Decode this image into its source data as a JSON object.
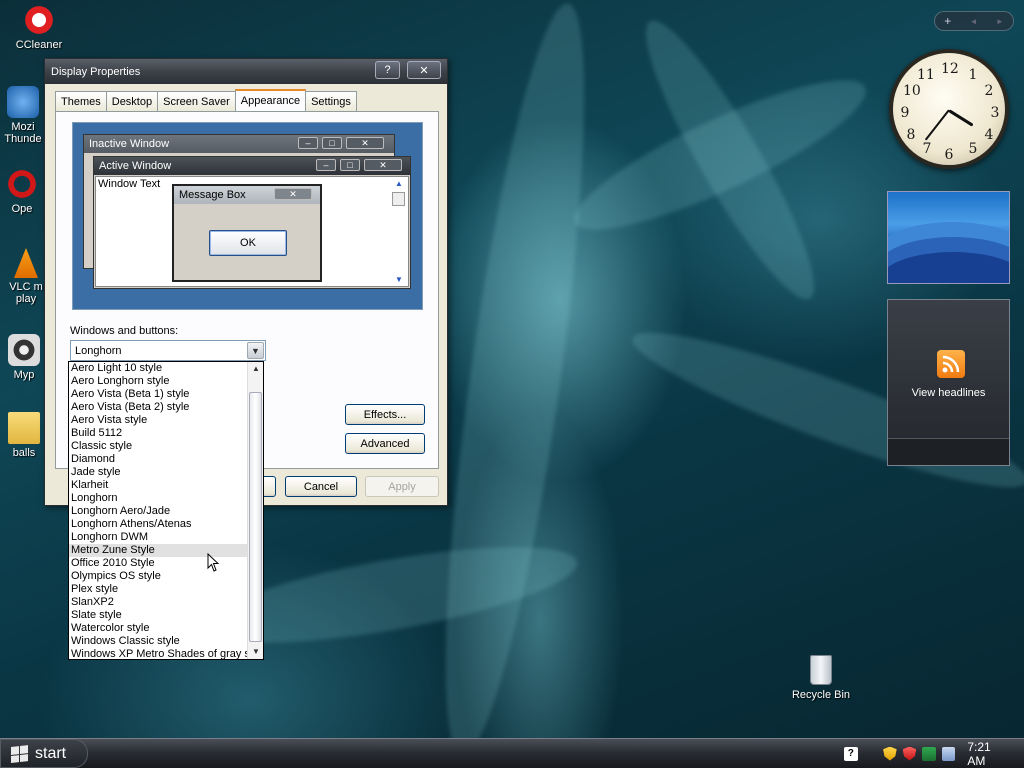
{
  "desktop_icons": [
    {
      "label": "CCleaner"
    },
    {
      "label": "Mozi\nThunde"
    },
    {
      "label": "Ope"
    },
    {
      "label": "VLC m\nplay"
    },
    {
      "label": "Myp"
    },
    {
      "label": "balls"
    }
  ],
  "recycle_bin": {
    "label": "Recycle Bin"
  },
  "gadgets": {
    "sidebar_buttons": [
      "+",
      "◄",
      "►"
    ],
    "feed": {
      "label": "View headlines",
      "icon": "rss-icon"
    },
    "clock_numbers": [
      "12",
      "1",
      "2",
      "3",
      "4",
      "5",
      "6",
      "7",
      "8",
      "9",
      "10",
      "11"
    ]
  },
  "window": {
    "title": "Display Properties",
    "help_btn": "?",
    "close_btn": "✕",
    "tabs": [
      {
        "label": "Themes"
      },
      {
        "label": "Desktop"
      },
      {
        "label": "Screen Saver"
      },
      {
        "label": "Appearance"
      },
      {
        "label": "Settings"
      }
    ],
    "preview": {
      "inactive_title": "Inactive Window",
      "active_title": "Active Window",
      "window_text": "Window Text",
      "msgbox_title": "Message Box",
      "ok": "OK"
    },
    "windows_buttons_label": "Windows and buttons:",
    "combo_value": "Longhorn",
    "effects_btn": "Effects...",
    "advanced_btn": "Advanced",
    "cancel_btn": "Cancel",
    "apply_btn": "Apply"
  },
  "dropdown_items": [
    "Aero Light 10 style",
    "Aero Longhorn style",
    "Aero Vista (Beta 1) style",
    "Aero Vista (Beta 2) style",
    "Aero Vista style",
    "Build 5112",
    "Classic style",
    "Diamond",
    "Jade style",
    "Klarheit",
    "Longhorn",
    "Longhorn Aero/Jade",
    "Longhorn Athens/Atenas",
    "Longhorn DWM",
    "Metro Zune Style",
    "Office 2010 Style",
    "Olympics OS style",
    "Plex style",
    "SlanXP2",
    "Slate style",
    "Watercolor style",
    "Windows Classic style",
    "Windows XP Metro Shades of gray st"
  ],
  "dropdown_highlighted": "Metro Zune Style",
  "taskbar": {
    "start_label": "start",
    "clock": "7:21 AM",
    "tray_icons": [
      "help-icon",
      "security-shield-icon",
      "antivirus-icon",
      "network-icon",
      "volume-icon"
    ]
  }
}
